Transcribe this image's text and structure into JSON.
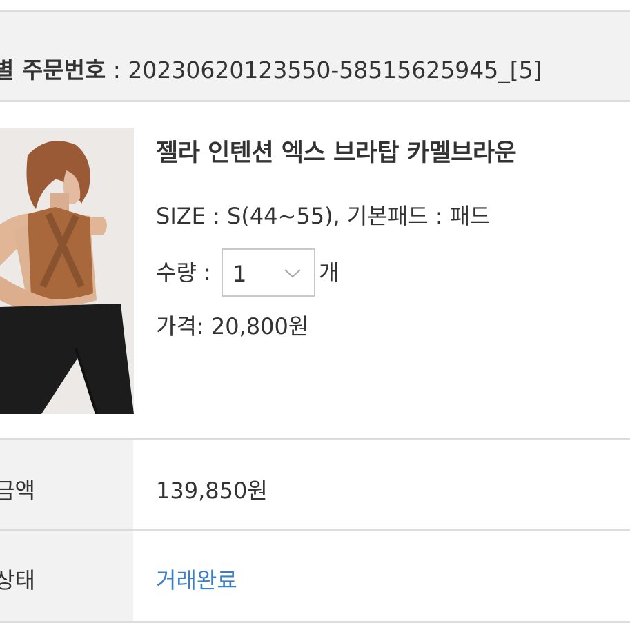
{
  "order": {
    "label": "별 주문번호",
    "separator": " : ",
    "number": "20230620123550-58515625945_[5]"
  },
  "product": {
    "image_icon": "product-photo",
    "name": "젤라 인텐션 엑스 브라탑 카멜브라운",
    "option_line": "SIZE : S(44~55), 기본패드 : 패드",
    "quantity_label": "수량 : ",
    "quantity_value": "1",
    "quantity_unit": "개",
    "price_line": "가격: 20,800원"
  },
  "summary": {
    "amount_label": "금액",
    "amount_value": "139,850원",
    "status_label": "상태",
    "status_value": "거래완료",
    "status_color": "#3a7fc8"
  },
  "colors": {
    "row_background": "#f2f2f2",
    "divider": "#dcdcdc",
    "text": "#333333"
  }
}
